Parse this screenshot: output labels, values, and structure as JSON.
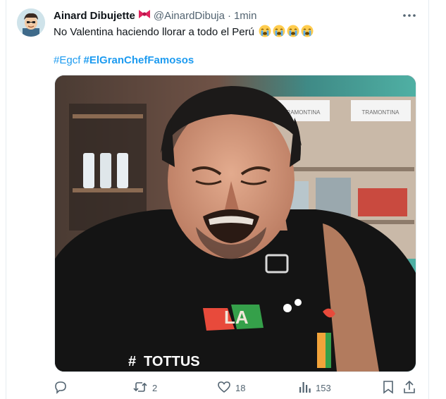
{
  "tweet": {
    "author_name": "Ainard Dibujette",
    "author_handle": "@AinardDibuja",
    "separator": "·",
    "time": "1min",
    "text": "No Valentina haciendo llorar a todo el Perú",
    "emoji_count": 4,
    "hashtags": [
      "#Egcf",
      "#ElGranChefFamosos"
    ]
  },
  "media": {
    "badge_text": "TOTTUS",
    "shirt_text": "LA",
    "shelf_label_left": "TRAMONTINA",
    "shelf_label_right": "TRAMONTINA"
  },
  "actions": {
    "reply_count": "",
    "retweet_count": "2",
    "like_count": "18",
    "views_count": "153"
  },
  "colors": {
    "link": "#1d9bf0",
    "muted": "#536471",
    "badge": "#e0245e"
  }
}
